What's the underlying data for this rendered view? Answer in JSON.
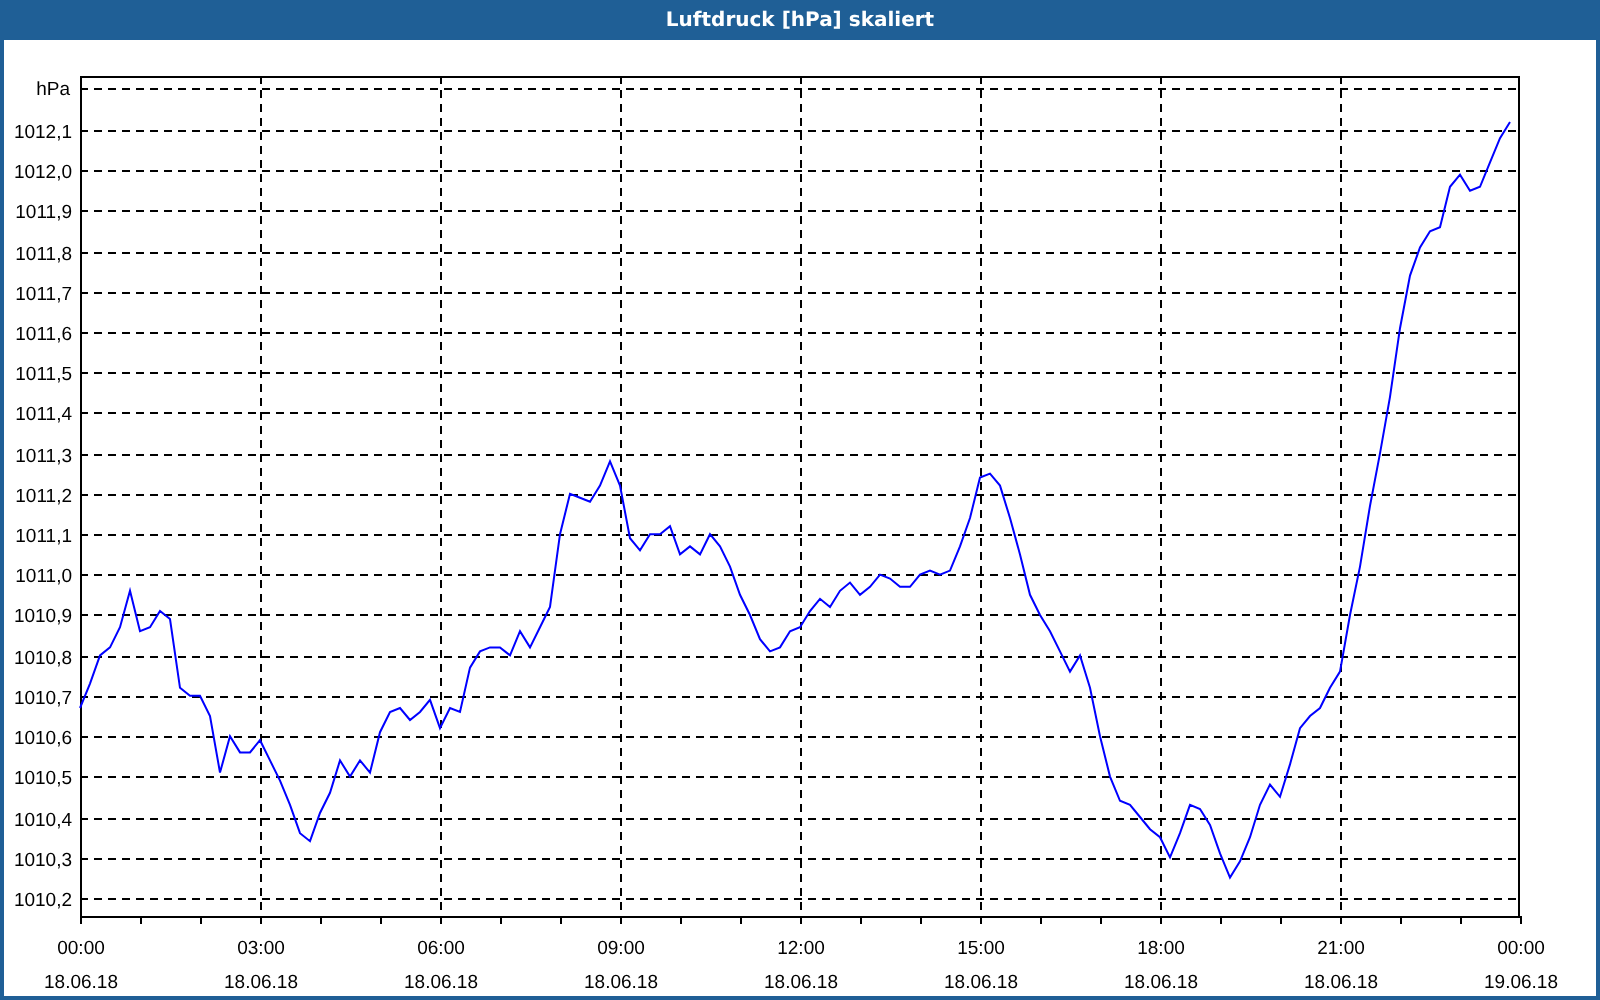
{
  "window": {
    "title": "Luftdruck [hPa] skaliert"
  },
  "chart": {
    "chart_data": {
      "type": "line",
      "grid": true,
      "ylabel": "hPa",
      "ylim": [
        1010.155,
        1012.234
      ],
      "yticks": [
        {
          "value": 1010.2,
          "label": "1010,2"
        },
        {
          "value": 1010.3,
          "label": "1010,3"
        },
        {
          "value": 1010.4,
          "label": "1010,4"
        },
        {
          "value": 1010.5,
          "label": "1010,5"
        },
        {
          "value": 1010.6,
          "label": "1010,6"
        },
        {
          "value": 1010.7,
          "label": "1010,7"
        },
        {
          "value": 1010.8,
          "label": "1010,8"
        },
        {
          "value": 1010.9,
          "label": "1010,9"
        },
        {
          "value": 1011.0,
          "label": "1011,0"
        },
        {
          "value": 1011.1,
          "label": "1011,1"
        },
        {
          "value": 1011.2,
          "label": "1011,2"
        },
        {
          "value": 1011.3,
          "label": "1011,3"
        },
        {
          "value": 1011.4,
          "label": "1011,4"
        },
        {
          "value": 1011.5,
          "label": "1011,5"
        },
        {
          "value": 1011.6,
          "label": "1011,6"
        },
        {
          "value": 1011.7,
          "label": "1011,7"
        },
        {
          "value": 1011.8,
          "label": "1011,8"
        },
        {
          "value": 1011.9,
          "label": "1011,9"
        },
        {
          "value": 1012.0,
          "label": "1012,0"
        },
        {
          "value": 1012.1,
          "label": "1012,1"
        }
      ],
      "categories": [
        "00:00\n18.06.18",
        null,
        null,
        null,
        null,
        null,
        null,
        null,
        null,
        null,
        null,
        null,
        null,
        null,
        null,
        null,
        null,
        null,
        "03:00\n18.06.18",
        null,
        null,
        null,
        null,
        null,
        null,
        null,
        null,
        null,
        null,
        null,
        null,
        null,
        null,
        null,
        null,
        null,
        "06:00\n18.06.18",
        null,
        null,
        null,
        null,
        null,
        null,
        null,
        null,
        null,
        null,
        null,
        null,
        null,
        null,
        null,
        null,
        null,
        "09:00\n18.06.18",
        null,
        null,
        null,
        null,
        null,
        null,
        null,
        null,
        null,
        null,
        null,
        null,
        null,
        null,
        null,
        null,
        null,
        "12:00\n18.06.18",
        null,
        null,
        null,
        null,
        null,
        null,
        null,
        null,
        null,
        null,
        null,
        null,
        null,
        null,
        null,
        null,
        null,
        "15:00\n18.06.18",
        null,
        null,
        null,
        null,
        null,
        null,
        null,
        null,
        null,
        null,
        null,
        null,
        null,
        null,
        null,
        null,
        null,
        "18:00\n18.06.18",
        null,
        null,
        null,
        null,
        null,
        null,
        null,
        null,
        null,
        null,
        null,
        null,
        null,
        null,
        null,
        null,
        null,
        "21:00\n18.06.18",
        null,
        null,
        null,
        null,
        null,
        null,
        null,
        null,
        null,
        null,
        null,
        null,
        null,
        null,
        null,
        null,
        null,
        "00:00\n19.06.18"
      ],
      "series": [
        {
          "color": "#0000ff",
          "values": [
            1010.67,
            1010.73,
            1010.8,
            1010.82,
            1010.87,
            1010.96,
            1010.86,
            1010.87,
            1010.91,
            1010.89,
            1010.72,
            1010.7,
            1010.7,
            1010.65,
            1010.51,
            1010.6,
            1010.56,
            1010.56,
            1010.59,
            1010.54,
            1010.49,
            1010.43,
            1010.36,
            1010.34,
            1010.41,
            1010.46,
            1010.54,
            1010.5,
            1010.54,
            1010.51,
            1010.61,
            1010.66,
            1010.67,
            1010.64,
            1010.66,
            1010.69,
            1010.62,
            1010.67,
            1010.66,
            1010.77,
            1010.81,
            1010.82,
            1010.82,
            1010.8,
            1010.86,
            1010.82,
            1010.87,
            1010.92,
            1011.1,
            1011.2,
            1011.19,
            1011.18,
            1011.22,
            1011.28,
            1011.22,
            1011.09,
            1011.06,
            1011.1,
            1011.1,
            1011.12,
            1011.05,
            1011.07,
            1011.05,
            1011.1,
            1011.07,
            1011.02,
            1010.95,
            1010.9,
            1010.84,
            1010.81,
            1010.82,
            1010.86,
            1010.87,
            1010.91,
            1010.94,
            1010.92,
            1010.96,
            1010.98,
            1010.95,
            1010.97,
            1011.0,
            1010.99,
            1010.97,
            1010.97,
            1011.0,
            1011.01,
            1011.0,
            1011.01,
            1011.07,
            1011.14,
            1011.24,
            1011.25,
            1011.22,
            1011.14,
            1011.05,
            1010.95,
            1010.9,
            1010.86,
            1010.81,
            1010.76,
            1010.8,
            1010.72,
            1010.6,
            1010.5,
            1010.44,
            1010.43,
            1010.4,
            1010.37,
            1010.35,
            1010.3,
            1010.36,
            1010.43,
            1010.42,
            1010.38,
            1010.31,
            1010.25,
            1010.29,
            1010.35,
            1010.43,
            1010.48,
            1010.45,
            1010.53,
            1010.62,
            1010.65,
            1010.67,
            1010.72,
            1010.76,
            1010.9,
            1011.02,
            1011.17,
            1011.3,
            1011.44,
            1011.61,
            1011.74,
            1011.81,
            1011.85,
            1011.86,
            1011.96,
            1011.99,
            1011.95,
            1011.96,
            1012.02,
            1012.08,
            1012.12,
            null
          ]
        }
      ]
    }
  }
}
